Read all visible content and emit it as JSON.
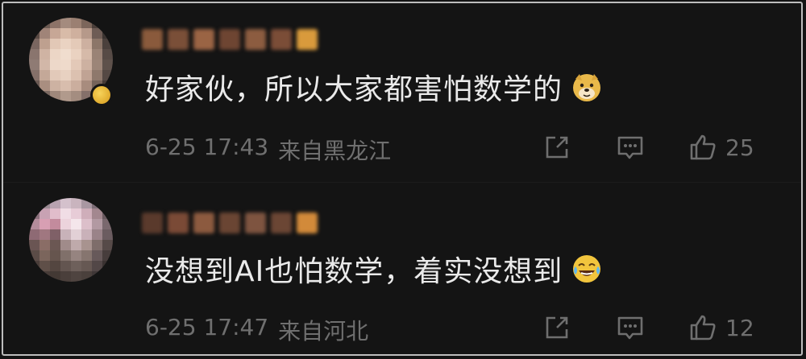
{
  "comments": [
    {
      "username": "",
      "text": "好家伙，所以大家都害怕数学的",
      "emoji_icon": "doge-emoji",
      "date": "6-25 17:43",
      "location": "来自黑龙江",
      "likes": "25"
    },
    {
      "username": "",
      "text": "没想到AI也怕数学，着实没想到",
      "emoji_icon": "laughing-tears-emoji",
      "date": "6-25 17:47",
      "location": "来自河北",
      "likes": "12"
    }
  ],
  "colors": {
    "background": "#141414",
    "text": "#eaeaea",
    "meta": "#6f6f6f",
    "badge": "#e2b02d"
  }
}
